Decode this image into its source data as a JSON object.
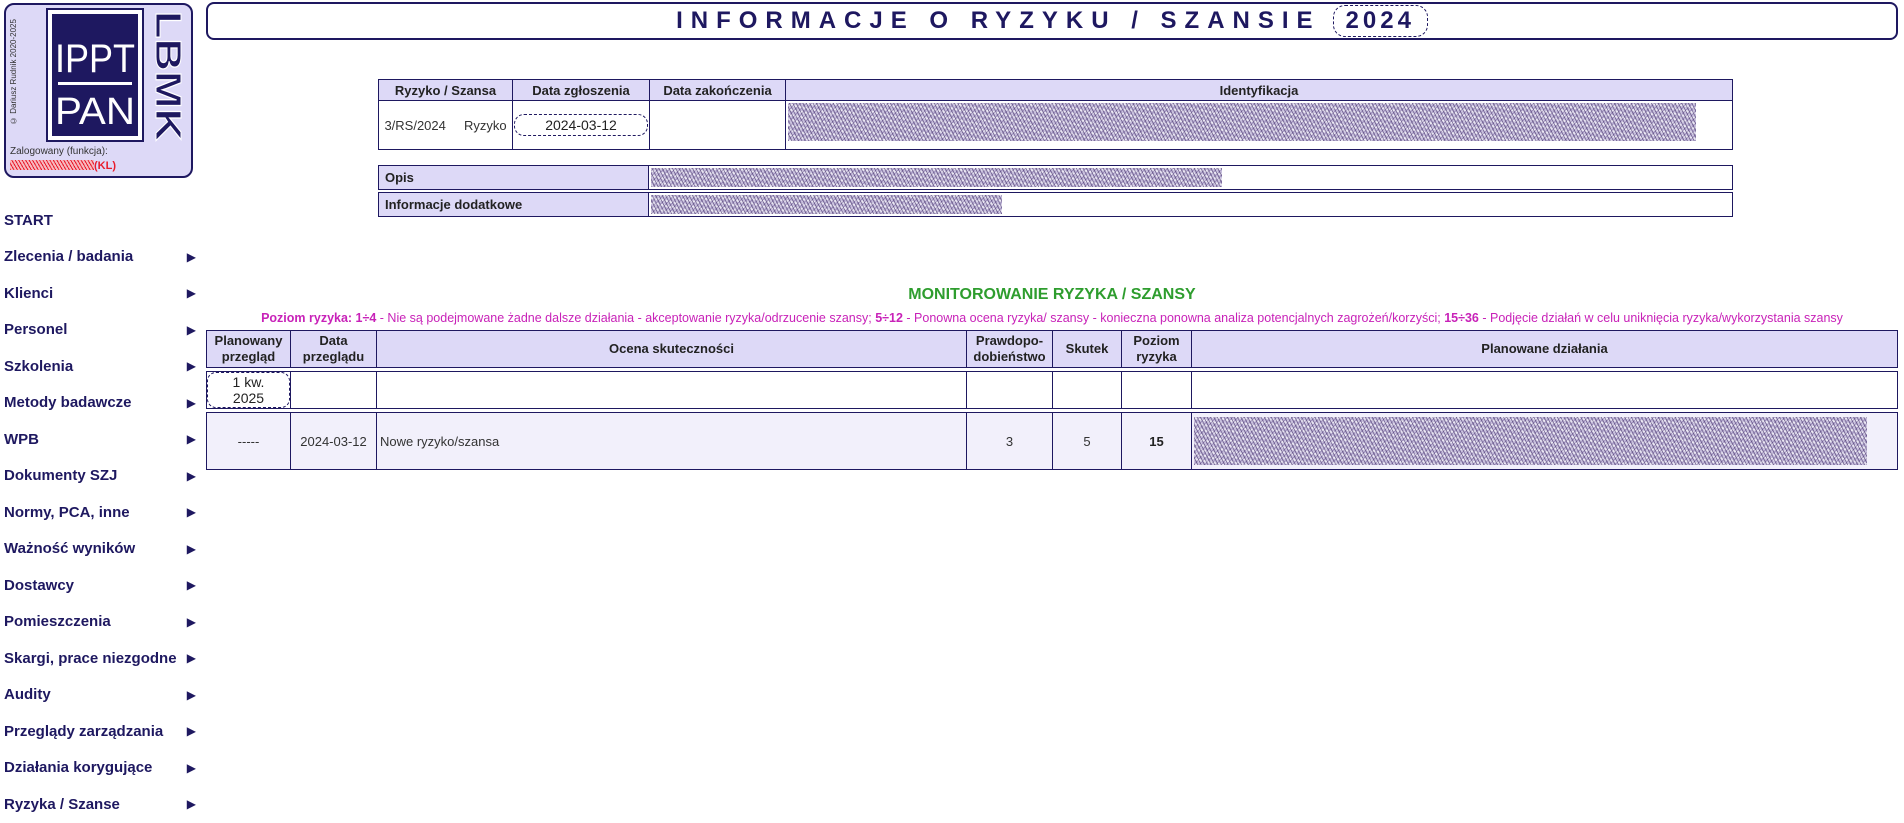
{
  "logo": {
    "copyright": "© Dariusz Rudnik 2020-2025",
    "ippt_text": "IPPT",
    "pan_text": "PAN",
    "lab_text": "LBMK",
    "login_label": "Zalogowany (funkcja):",
    "login_role": "(KL)"
  },
  "nav": {
    "items": [
      {
        "label": "START",
        "has_arrow": false
      },
      {
        "label": "Zlecenia / badania",
        "has_arrow": true
      },
      {
        "label": "Klienci",
        "has_arrow": true
      },
      {
        "label": "Personel",
        "has_arrow": true
      },
      {
        "label": "Szkolenia",
        "has_arrow": true
      },
      {
        "label": "Metody badawcze",
        "has_arrow": true
      },
      {
        "label": "WPB",
        "has_arrow": true
      },
      {
        "label": "Dokumenty SZJ",
        "has_arrow": true
      },
      {
        "label": "Normy, PCA, inne",
        "has_arrow": true
      },
      {
        "label": "Ważność wyników",
        "has_arrow": true
      },
      {
        "label": "Dostawcy",
        "has_arrow": true
      },
      {
        "label": "Pomieszczenia",
        "has_arrow": true
      },
      {
        "label": "Skargi, prace niezgodne",
        "has_arrow": true
      },
      {
        "label": "Audity",
        "has_arrow": true
      },
      {
        "label": "Przeglądy zarządzania",
        "has_arrow": true
      },
      {
        "label": "Działania korygujące",
        "has_arrow": true
      },
      {
        "label": "Ryzyka / Szanse",
        "has_arrow": true
      }
    ],
    "arrow_glyph": "▶"
  },
  "header": {
    "title": "INFORMACJE O RYZYKU / SZANSIE",
    "year": "2024"
  },
  "info": {
    "headers": [
      "Ryzyko / Szansa",
      "Data zgłoszenia",
      "Data zakończenia",
      "Identyfikacja"
    ],
    "number": "3/RS/2024",
    "type": "Ryzyko",
    "report_date": "2024-03-12",
    "end_date": ""
  },
  "desc": {
    "opis_label": "Opis",
    "extra_label": "Informacje dodatkowe"
  },
  "monitoring": {
    "title": "MONITOROWANIE RYZYKA / SZANSY",
    "legend": {
      "prefix": "Poziom ryzyka: 1÷4",
      "low_text": " - Nie są podejmowane żadne dalsze działania - akceptowanie ryzyka/odrzucenie szansy; ",
      "mid_range": "5÷12",
      "mid_text": " - Ponowna ocena ryzyka/ szansy - konieczna ponowna analiza potencjalnych zagrożeń/korzyści; ",
      "high_range": "15÷36",
      "high_text": " - Podjęcie działań w celu uniknięcia ryzyka/wykorzystania szansy"
    },
    "headers": {
      "planned_review": [
        "Planowany",
        "przegląd"
      ],
      "review_date": [
        "Data",
        "przeglądu"
      ],
      "effectiveness": "Ocena skuteczności",
      "probability": [
        "Prawdopo-",
        "dobieństwo"
      ],
      "effect": "Skutek",
      "risk_level": [
        "Poziom",
        "ryzyka"
      ],
      "planned_actions": "Planowane działania"
    },
    "input_row": {
      "planned_review": "1 kw. 2025"
    },
    "rows": [
      {
        "planned_review": "-----",
        "review_date": "2024-03-12",
        "effectiveness": "Nowe ryzyko/szansa",
        "probability": "3",
        "effect": "5",
        "risk_level": "15"
      }
    ]
  },
  "colors": {
    "primary": "#1e1860",
    "panel_bg": "#ddd9f7",
    "green_title": "#2e9d2e",
    "legend_magenta": "#c822b8",
    "login_red": "#e81c2c"
  }
}
